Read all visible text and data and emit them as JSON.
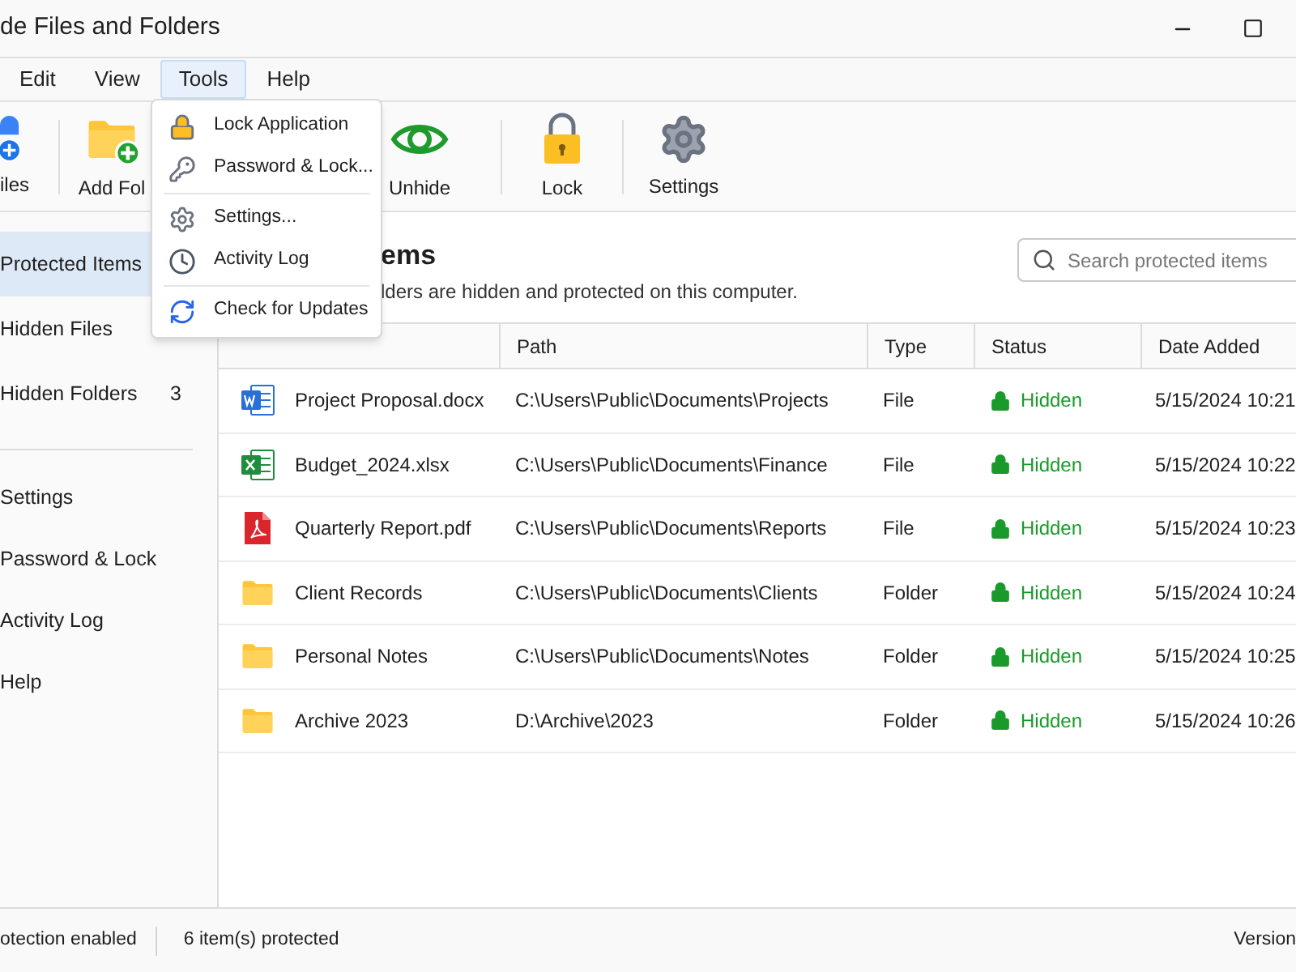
{
  "window": {
    "title": "de Files and Folders"
  },
  "menu_bar": [
    {
      "label": "Edit",
      "selected": false
    },
    {
      "label": "View",
      "selected": false
    },
    {
      "label": "Tools",
      "selected": true
    },
    {
      "label": "Help",
      "selected": false
    }
  ],
  "tools_menu": [
    [
      {
        "kind": "lock",
        "label": "Lock Application"
      },
      {
        "kind": "key",
        "label": "Password & Lock..."
      }
    ],
    [
      {
        "kind": "settings",
        "label": "Settings..."
      },
      {
        "kind": "clock",
        "label": "Activity Log"
      }
    ],
    [
      {
        "kind": "refresh",
        "label": "Check for Updates"
      }
    ]
  ],
  "toolbar": [
    {
      "kind": "add-file",
      "label": "iles"
    },
    {
      "kind": "add-folder",
      "label": "Add Fol"
    },
    {
      "kind": "unhide",
      "label": "Unhide"
    },
    {
      "kind": "lock",
      "label": "Lock"
    },
    {
      "kind": "settings",
      "label": "Settings"
    }
  ],
  "sidebar": {
    "groups": [
      [
        {
          "label": "Protected Items",
          "selected": true
        },
        {
          "label": "Hidden Files",
          "selected": false
        },
        {
          "label": "Hidden Folders",
          "count": "3",
          "selected": false
        }
      ],
      [
        {
          "label": "Settings",
          "selected": false
        },
        {
          "label": "Password & Lock",
          "selected": false
        },
        {
          "label": "Activity Log",
          "selected": false
        },
        {
          "label": "Help",
          "selected": false
        }
      ]
    ]
  },
  "heading": "ems",
  "subtitle": "lders are hidden and protected on this computer.",
  "search": {
    "placeholder": "Search protected items"
  },
  "table": {
    "columns": [
      "Path",
      "Type",
      "Status",
      "Date Added"
    ],
    "rows": [
      {
        "kind": "word",
        "name": "Project Proposal.docx",
        "path": "C:\\Users\\Public\\Documents\\Projects",
        "type": "File",
        "status": "Hidden",
        "date": "5/15/2024 10:21"
      },
      {
        "kind": "excel",
        "name": "Budget_2024.xlsx",
        "path": "C:\\Users\\Public\\Documents\\Finance",
        "type": "File",
        "status": "Hidden",
        "date": "5/15/2024 10:22"
      },
      {
        "kind": "pdf",
        "name": "Quarterly Report.pdf",
        "path": "C:\\Users\\Public\\Documents\\Reports",
        "type": "File",
        "status": "Hidden",
        "date": "5/15/2024 10:23"
      },
      {
        "kind": "folder",
        "name": "Client Records",
        "path": "C:\\Users\\Public\\Documents\\Clients",
        "type": "Folder",
        "status": "Hidden",
        "date": "5/15/2024 10:24"
      },
      {
        "kind": "folder",
        "name": "Personal Notes",
        "path": "C:\\Users\\Public\\Documents\\Notes",
        "type": "Folder",
        "status": "Hidden",
        "date": "5/15/2024 10:25"
      },
      {
        "kind": "folder",
        "name": "Archive 2023",
        "path": "D:\\Archive\\2023",
        "type": "Folder",
        "status": "Hidden",
        "date": "5/15/2024 10:26"
      }
    ]
  },
  "status_bar": {
    "left": "otection enabled",
    "count": "6 item(s) protected",
    "right": "Version"
  }
}
